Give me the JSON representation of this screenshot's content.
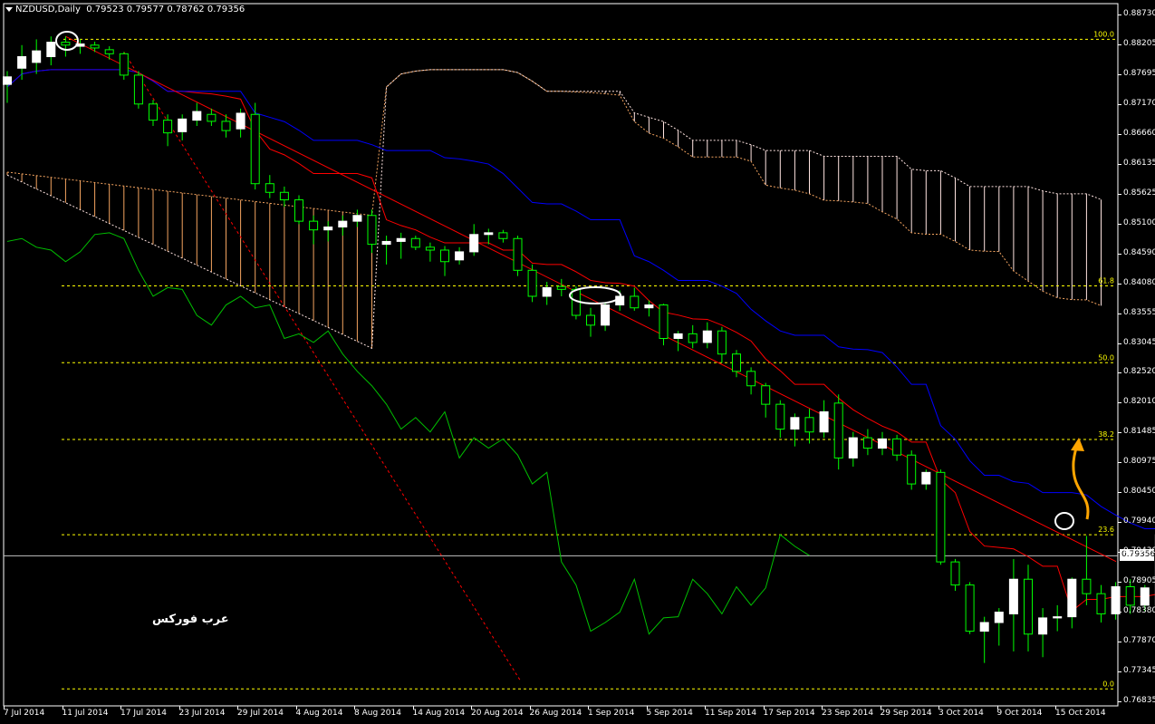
{
  "window": {
    "symbol_title": "NZDUSD,Daily",
    "ohlc": "0.79523 0.79577 0.78762 0.79356"
  },
  "watermark": "عرب فوركس",
  "current_price": "0.79356",
  "colors": {
    "background": "#000000",
    "bull_candle": "#ffffff",
    "bear_candle": "#000000",
    "candle_wick": "#00ff00",
    "tenkan": "#ff0000",
    "kijun": "#0000ff",
    "chikou": "#00c000",
    "trendline": "#ff0000",
    "fib_lines": "#ffff00",
    "kumo_bull": "#f4a460",
    "kumo_bear": "#ffe4e1",
    "arrow": "#ffa500",
    "markers": "#ffffff"
  },
  "price_axis": [
    "0.88730",
    "0.88205",
    "0.87695",
    "0.87170",
    "0.86660",
    "0.86135",
    "0.85625",
    "0.85100",
    "0.84590",
    "0.84080",
    "0.83555",
    "0.83045",
    "0.82520",
    "0.82010",
    "0.81485",
    "0.80975",
    "0.80450",
    "0.79940",
    "0.79430",
    "0.78905",
    "0.78380",
    "0.77870",
    "0.77345",
    "0.76835"
  ],
  "time_axis": [
    "7 Jul 2014",
    "11 Jul 2014",
    "17 Jul 2014",
    "23 Jul 2014",
    "29 Jul 2014",
    "4 Aug 2014",
    "8 Aug 2014",
    "14 Aug 2014",
    "20 Aug 2014",
    "26 Aug 2014",
    "1 Sep 2014",
    "5 Sep 2014",
    "11 Sep 2014",
    "17 Sep 2014",
    "23 Sep 2014",
    "29 Sep 2014",
    "3 Oct 2014",
    "9 Oct 2014",
    "15 Oct 2014"
  ],
  "fib_levels": [
    {
      "label": "100.0",
      "price": 0.883
    },
    {
      "label": "61.8",
      "price": 0.8403
    },
    {
      "label": "50.0",
      "price": 0.827
    },
    {
      "label": "38.2",
      "price": 0.8137
    },
    {
      "label": "23.6",
      "price": 0.7972
    },
    {
      "label": "0.0",
      "price": 0.7705
    }
  ],
  "chart_data": {
    "type": "candlestick",
    "ylim": [
      0.7665,
      0.888
    ],
    "candles": [
      [
        0.8752,
        0.8775,
        0.872,
        0.8765
      ],
      [
        0.878,
        0.882,
        0.876,
        0.88
      ],
      [
        0.879,
        0.883,
        0.877,
        0.881
      ],
      [
        0.88,
        0.8835,
        0.8785,
        0.8825
      ],
      [
        0.8825,
        0.8835,
        0.88,
        0.882
      ],
      [
        0.8818,
        0.883,
        0.8805,
        0.8822
      ],
      [
        0.882,
        0.8826,
        0.8808,
        0.8815
      ],
      [
        0.8812,
        0.8818,
        0.8795,
        0.8805
      ],
      [
        0.8805,
        0.8808,
        0.876,
        0.8768
      ],
      [
        0.8768,
        0.8775,
        0.871,
        0.8718
      ],
      [
        0.8718,
        0.8725,
        0.868,
        0.869
      ],
      [
        0.869,
        0.87,
        0.8645,
        0.8668
      ],
      [
        0.867,
        0.87,
        0.8655,
        0.8692
      ],
      [
        0.869,
        0.872,
        0.868,
        0.8705
      ],
      [
        0.87,
        0.871,
        0.868,
        0.8688
      ],
      [
        0.8688,
        0.87,
        0.866,
        0.8672
      ],
      [
        0.8675,
        0.871,
        0.866,
        0.8702
      ],
      [
        0.87,
        0.872,
        0.857,
        0.858
      ],
      [
        0.858,
        0.8595,
        0.8555,
        0.8565
      ],
      [
        0.8565,
        0.8575,
        0.854,
        0.8552
      ],
      [
        0.8552,
        0.856,
        0.851,
        0.8515
      ],
      [
        0.8515,
        0.8525,
        0.8475,
        0.85
      ],
      [
        0.85,
        0.8515,
        0.848,
        0.8505
      ],
      [
        0.8505,
        0.8525,
        0.849,
        0.8515
      ],
      [
        0.8515,
        0.8535,
        0.8505,
        0.8525
      ],
      [
        0.8525,
        0.8535,
        0.846,
        0.8475
      ],
      [
        0.8475,
        0.849,
        0.844,
        0.848
      ],
      [
        0.848,
        0.8495,
        0.845,
        0.8485
      ],
      [
        0.8485,
        0.849,
        0.8465,
        0.847
      ],
      [
        0.847,
        0.8478,
        0.8445,
        0.8465
      ],
      [
        0.8465,
        0.8472,
        0.842,
        0.8445
      ],
      [
        0.8448,
        0.847,
        0.844,
        0.8462
      ],
      [
        0.8462,
        0.851,
        0.8455,
        0.8492
      ],
      [
        0.8492,
        0.8502,
        0.8475,
        0.8495
      ],
      [
        0.8495,
        0.85,
        0.8478,
        0.8485
      ],
      [
        0.8485,
        0.849,
        0.842,
        0.843
      ],
      [
        0.843,
        0.844,
        0.8375,
        0.8385
      ],
      [
        0.8385,
        0.841,
        0.837,
        0.84
      ],
      [
        0.8402,
        0.8415,
        0.8385,
        0.8397
      ],
      [
        0.8397,
        0.8402,
        0.8345,
        0.8352
      ],
      [
        0.8352,
        0.8365,
        0.8315,
        0.8335
      ],
      [
        0.8335,
        0.8375,
        0.8325,
        0.837
      ],
      [
        0.837,
        0.8395,
        0.836,
        0.8385
      ],
      [
        0.8385,
        0.84,
        0.836,
        0.8365
      ],
      [
        0.8365,
        0.8378,
        0.835,
        0.837
      ],
      [
        0.837,
        0.8372,
        0.83,
        0.8312
      ],
      [
        0.8312,
        0.8325,
        0.829,
        0.832
      ],
      [
        0.832,
        0.8335,
        0.8295,
        0.8305
      ],
      [
        0.8305,
        0.834,
        0.8295,
        0.8325
      ],
      [
        0.8325,
        0.8332,
        0.827,
        0.8285
      ],
      [
        0.8285,
        0.8292,
        0.8245,
        0.8255
      ],
      [
        0.8255,
        0.8262,
        0.8215,
        0.823
      ],
      [
        0.823,
        0.8235,
        0.8175,
        0.8198
      ],
      [
        0.8198,
        0.8205,
        0.814,
        0.8155
      ],
      [
        0.8155,
        0.8182,
        0.8125,
        0.8175
      ],
      [
        0.8175,
        0.819,
        0.813,
        0.815
      ],
      [
        0.815,
        0.8205,
        0.814,
        0.8185
      ],
      [
        0.82,
        0.8215,
        0.8085,
        0.8105
      ],
      [
        0.8105,
        0.815,
        0.809,
        0.814
      ],
      [
        0.814,
        0.8155,
        0.811,
        0.8122
      ],
      [
        0.8122,
        0.815,
        0.811,
        0.8138
      ],
      [
        0.8138,
        0.8145,
        0.81,
        0.811
      ],
      [
        0.811,
        0.8118,
        0.805,
        0.806
      ],
      [
        0.806,
        0.8085,
        0.805,
        0.808
      ],
      [
        0.808,
        0.8085,
        0.792,
        0.7925
      ],
      [
        0.7925,
        0.793,
        0.7875,
        0.7885
      ],
      [
        0.7885,
        0.789,
        0.78,
        0.7805
      ],
      [
        0.7805,
        0.783,
        0.775,
        0.782
      ],
      [
        0.782,
        0.7845,
        0.778,
        0.7838
      ],
      [
        0.7835,
        0.793,
        0.777,
        0.7895
      ],
      [
        0.7895,
        0.792,
        0.777,
        0.78
      ],
      [
        0.78,
        0.7845,
        0.776,
        0.7828
      ],
      [
        0.7828,
        0.785,
        0.7805,
        0.783
      ],
      [
        0.783,
        0.7898,
        0.781,
        0.7895
      ],
      [
        0.7895,
        0.797,
        0.785,
        0.787
      ],
      [
        0.787,
        0.7885,
        0.782,
        0.7835
      ],
      [
        0.7835,
        0.789,
        0.7825,
        0.7882
      ],
      [
        0.7882,
        0.7895,
        0.7835,
        0.785
      ],
      [
        0.785,
        0.7885,
        0.784,
        0.788
      ],
      [
        0.785,
        0.798,
        0.784,
        0.7972
      ],
      [
        0.7972,
        0.799,
        0.794,
        0.7952
      ],
      [
        0.7952,
        0.7958,
        0.7876,
        0.7936
      ]
    ]
  }
}
